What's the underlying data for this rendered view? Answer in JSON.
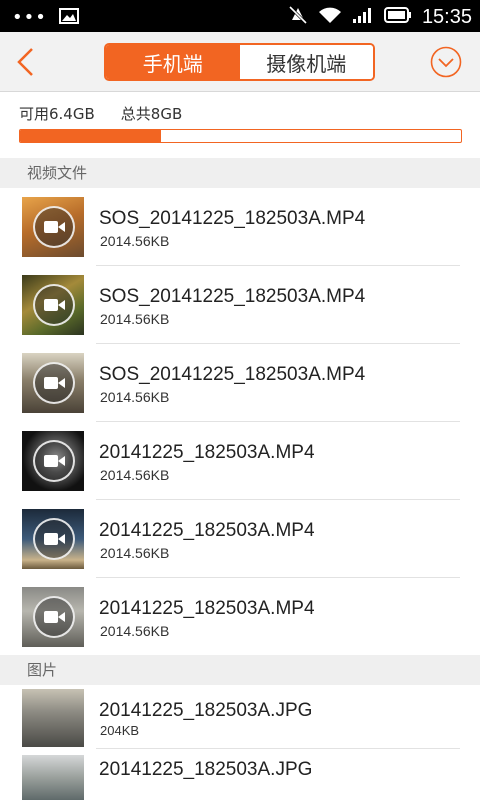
{
  "status_bar": {
    "time": "15:35",
    "icons": [
      "more-dots-icon",
      "image-icon",
      "mute-icon",
      "wifi-icon",
      "signal-icon",
      "battery-icon"
    ]
  },
  "header": {
    "tabs": [
      {
        "label": "手机端",
        "active": true
      },
      {
        "label": "摄像机端",
        "active": false
      }
    ],
    "accent_color": "#f26522"
  },
  "storage": {
    "available": "可用6.4GB",
    "total": "总共8GB",
    "used_fraction": 0.32
  },
  "sections": {
    "videos": {
      "title": "视频文件",
      "items": [
        {
          "name": "SOS_20141225_182503A.MP4",
          "size": "2014.56KB"
        },
        {
          "name": "SOS_20141225_182503A.MP4",
          "size": "2014.56KB"
        },
        {
          "name": "SOS_20141225_182503A.MP4",
          "size": "2014.56KB"
        },
        {
          "name": "20141225_182503A.MP4",
          "size": "2014.56KB"
        },
        {
          "name": "20141225_182503A.MP4",
          "size": "2014.56KB"
        },
        {
          "name": "20141225_182503A.MP4",
          "size": "2014.56KB"
        }
      ]
    },
    "photos": {
      "title": "图片",
      "items": [
        {
          "name": "20141225_182503A.JPG",
          "size": "204KB"
        },
        {
          "name": "20141225_182503A.JPG",
          "size": ""
        }
      ]
    }
  }
}
